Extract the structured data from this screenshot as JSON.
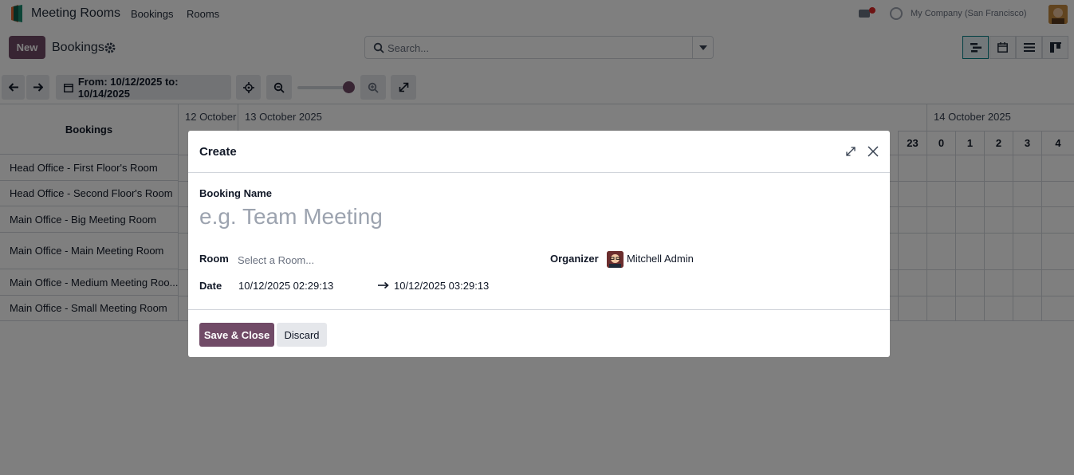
{
  "navbar": {
    "app_name": "Meeting Rooms",
    "menu": [
      "Bookings",
      "Rooms"
    ],
    "company": "My Company (San Francisco)"
  },
  "control_panel": {
    "new_label": "New",
    "title": "Bookings",
    "search_placeholder": "Search..."
  },
  "toolbar": {
    "range_label": "From: 10/12/2025 to: 10/14/2025"
  },
  "gantt": {
    "header_title": "Bookings",
    "days": [
      "12 October",
      "13 October 2025",
      "14 October 2025"
    ],
    "hours": [
      "23",
      "0",
      "1",
      "2",
      "3",
      "4"
    ],
    "rows": [
      "Head Office - First Floor's Room",
      "Head Office - Second Floor's Room",
      "Main Office - Big Meeting Room",
      "Main Office - Main Meeting Room",
      "Main Office - Medium Meeting Roo...",
      "Main Office - Small Meeting Room"
    ]
  },
  "modal": {
    "title": "Create",
    "booking_name_label": "Booking Name",
    "booking_name_placeholder": "e.g. Team Meeting",
    "room_label": "Room",
    "room_placeholder": "Select a Room...",
    "organizer_label": "Organizer",
    "organizer_name": "Mitchell Admin",
    "date_label": "Date",
    "date_start": "10/12/2025 02:29:13",
    "date_end": "10/12/2025 03:29:13",
    "save_label": "Save & Close",
    "discard_label": "Discard"
  },
  "colors": {
    "brand": "#714b67",
    "active_view": "#017e84"
  }
}
